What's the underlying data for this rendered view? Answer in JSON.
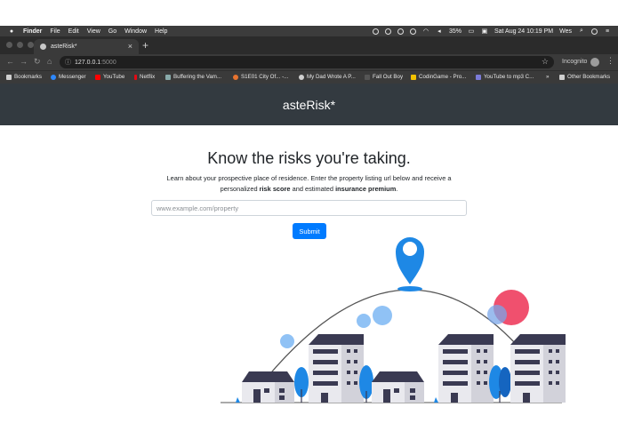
{
  "menubar": {
    "apple": "",
    "app": "Finder",
    "items": [
      "File",
      "Edit",
      "View",
      "Go",
      "Window",
      "Help"
    ],
    "battery": "35%",
    "datetime": "Sat Aug 24  10:19 PM",
    "user": "Wes"
  },
  "browser": {
    "tab_title": "asteRisk*",
    "close": "×",
    "new_tab": "+",
    "url_host": "127.0.0.1",
    "url_port": ":5000",
    "incognito": "Incognito"
  },
  "bookmarks": {
    "items": [
      {
        "label": "Bookmarks",
        "color": "#cfcfcf"
      },
      {
        "label": "Messenger",
        "color": "#2d88ff"
      },
      {
        "label": "YouTube",
        "color": "#ff0000"
      },
      {
        "label": "Netflix",
        "color": "#e50914"
      },
      {
        "label": "Buffering the Vam...",
        "color": "#8aa"
      },
      {
        "label": "S1E01 City Of... -...",
        "color": "#e8732f"
      },
      {
        "label": "My Dad Wrote A P...",
        "color": "#cfcfcf"
      },
      {
        "label": "Fall Out Boy",
        "color": "#555"
      },
      {
        "label": "CodinGame - Pro...",
        "color": "#f2c200"
      },
      {
        "label": "YouTube to mp3 C...",
        "color": "#7b7bd8"
      }
    ],
    "more": "»",
    "other": "Other Bookmarks"
  },
  "site": {
    "brand": "asteRisk*",
    "headline": "Know the risks you're taking.",
    "lead_part1": "Learn about your prospective place of residence. Enter the property listing url below and receive a personalized ",
    "lead_bold1": "risk score",
    "lead_part2": " and estimated ",
    "lead_bold2": "insurance premium",
    "lead_part3": ".",
    "input_placeholder": "www.example.com/property",
    "submit_label": "Submit"
  },
  "colors": {
    "header_bg": "#333a40",
    "primary": "#007bff",
    "pin": "#1e88e5",
    "bubble_pink": "#f0506e",
    "bubble_blue": "#90c2f5",
    "building_roof": "#3a3a52",
    "building_wall": "#e9e9ee",
    "tree": "#1e88e5"
  }
}
